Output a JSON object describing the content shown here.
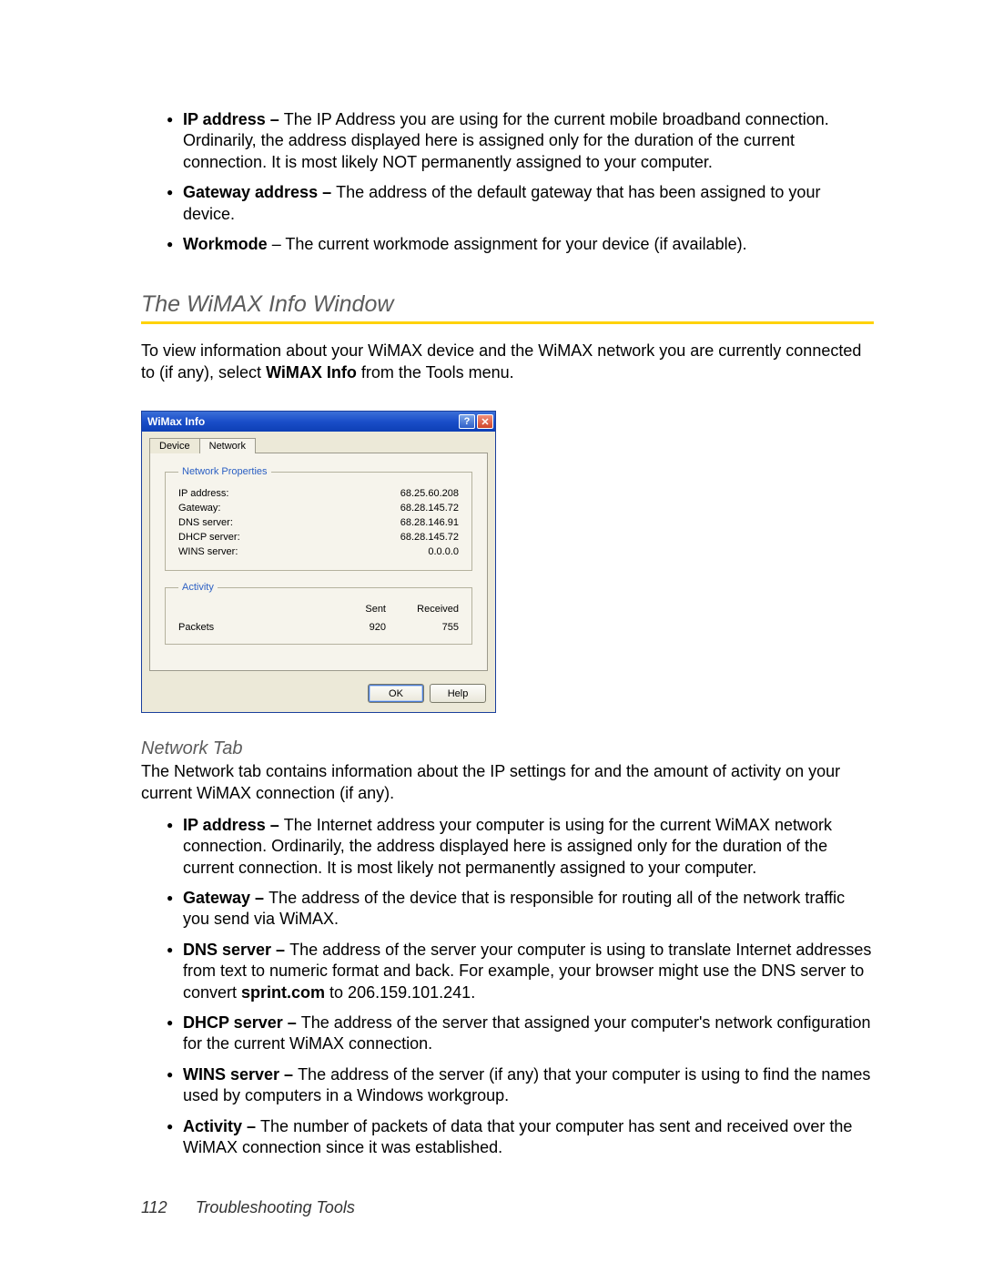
{
  "top_bullets": [
    {
      "term": "IP address – ",
      "desc": "The IP Address you are using for the current mobile broadband connection. Ordinarily, the address displayed here is assigned only for the duration of the current connection. It is most likely NOT permanently assigned to your computer."
    },
    {
      "term": "Gateway address – ",
      "desc": "The address of the default gateway that has been assigned to your device."
    },
    {
      "term": "Workmode",
      "desc": " – The current workmode assignment for your device (if available)."
    }
  ],
  "section_title": "The WiMAX Info Window",
  "intro_part1": "To view information about your WiMAX device and the WiMAX network you are currently connected to (if any), select ",
  "intro_bold": "WiMAX Info",
  "intro_part2": " from the Tools menu.",
  "window": {
    "title": "WiMax Info",
    "tab_device": "Device",
    "tab_network": "Network",
    "group_network": "Network Properties",
    "props": {
      "ip_label": "IP address:",
      "ip_val": "68.25.60.208",
      "gw_label": "Gateway:",
      "gw_val": "68.28.145.72",
      "dns_label": "DNS server:",
      "dns_val": "68.28.146.91",
      "dhcp_label": "DHCP server:",
      "dhcp_val": "68.28.145.72",
      "wins_label": "WINS server:",
      "wins_val": "0.0.0.0"
    },
    "group_activity": "Activity",
    "col_sent": "Sent",
    "col_recv": "Received",
    "row_packets": "Packets",
    "packets_sent": "920",
    "packets_recv": "755",
    "btn_ok": "OK",
    "btn_help": "Help"
  },
  "subheading": "Network Tab",
  "sub_intro": "The Network tab contains information about the IP settings for and the amount of activity on your current WiMAX connection (if any).",
  "defs": [
    {
      "term": "IP address – ",
      "desc": "The Internet address your computer is using for the current WiMAX network connection. Ordinarily, the address displayed here is assigned only for the duration of the current connection. It is most likely not permanently assigned to your computer."
    },
    {
      "term": "Gateway – ",
      "desc": "The address of the device that is responsible for routing all of the network traffic you send via WiMAX."
    },
    {
      "term": "DNS server – ",
      "pre": "The address of the server your computer is using to translate Internet addresses from text to numeric format and back. For example, your browser might use the DNS server to convert ",
      "bold": "sprint.com",
      "post": " to 206.159.101.241."
    },
    {
      "term": "DHCP server – ",
      "desc": "The address of the server that assigned your computer's network configuration for the current WiMAX connection."
    },
    {
      "term": "WINS server – ",
      "desc": "The address of the server (if any) that your computer is using to find the names used by computers in a Windows workgroup."
    },
    {
      "term": "Activity – ",
      "desc": "The number of packets of data that your computer has sent and received over the WiMAX connection since it was established."
    }
  ],
  "footer_page": "112",
  "footer_text": "Troubleshooting Tools"
}
